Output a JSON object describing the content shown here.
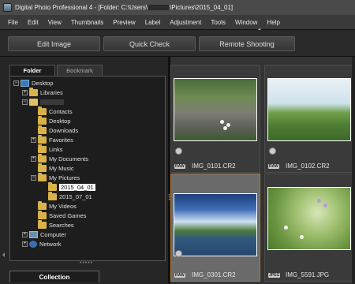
{
  "window": {
    "title_prefix": "Digital Photo Professional 4 - [Folder: C:\\Users\\",
    "title_suffix": "\\Pictures\\2015_04_01]"
  },
  "menu": [
    "File",
    "Edit",
    "View",
    "Thumbnails",
    "Preview",
    "Label",
    "Adjustment",
    "Tools",
    "Window",
    "Help"
  ],
  "toolbar": {
    "edit_image": "Edit Image",
    "quick_check": "Quick Check",
    "remote_shooting": "Remote Shooting"
  },
  "panel_tabs": {
    "folder": "Folder",
    "bookmark": "Bookmark"
  },
  "tree": {
    "desktop": "Desktop",
    "libraries": "Libraries",
    "contacts": "Contacts",
    "desktop_sub": "Desktop",
    "downloads": "Downloads",
    "favorites": "Favorites",
    "links": "Links",
    "my_documents": "My Documents",
    "my_music": "My Music",
    "my_pictures": "My Pictures",
    "folder_2015_04_01": "2015_04_01",
    "folder_2015_07_01": "2015_07_01",
    "my_videos": "My Videos",
    "saved_games": "Saved Games",
    "searches": "Searches",
    "computer": "Computer",
    "network": "Network"
  },
  "collection_tab": "Collection",
  "thumbnails": [
    {
      "name": "IMG_0101.CR2",
      "format": "RAW"
    },
    {
      "name": "IMG_0102.CR2",
      "format": "RAW"
    },
    {
      "name": "IMG_0301.CR2",
      "format": "RAW"
    },
    {
      "name": "IMG_5591.JPG",
      "format": "JPEG"
    }
  ]
}
